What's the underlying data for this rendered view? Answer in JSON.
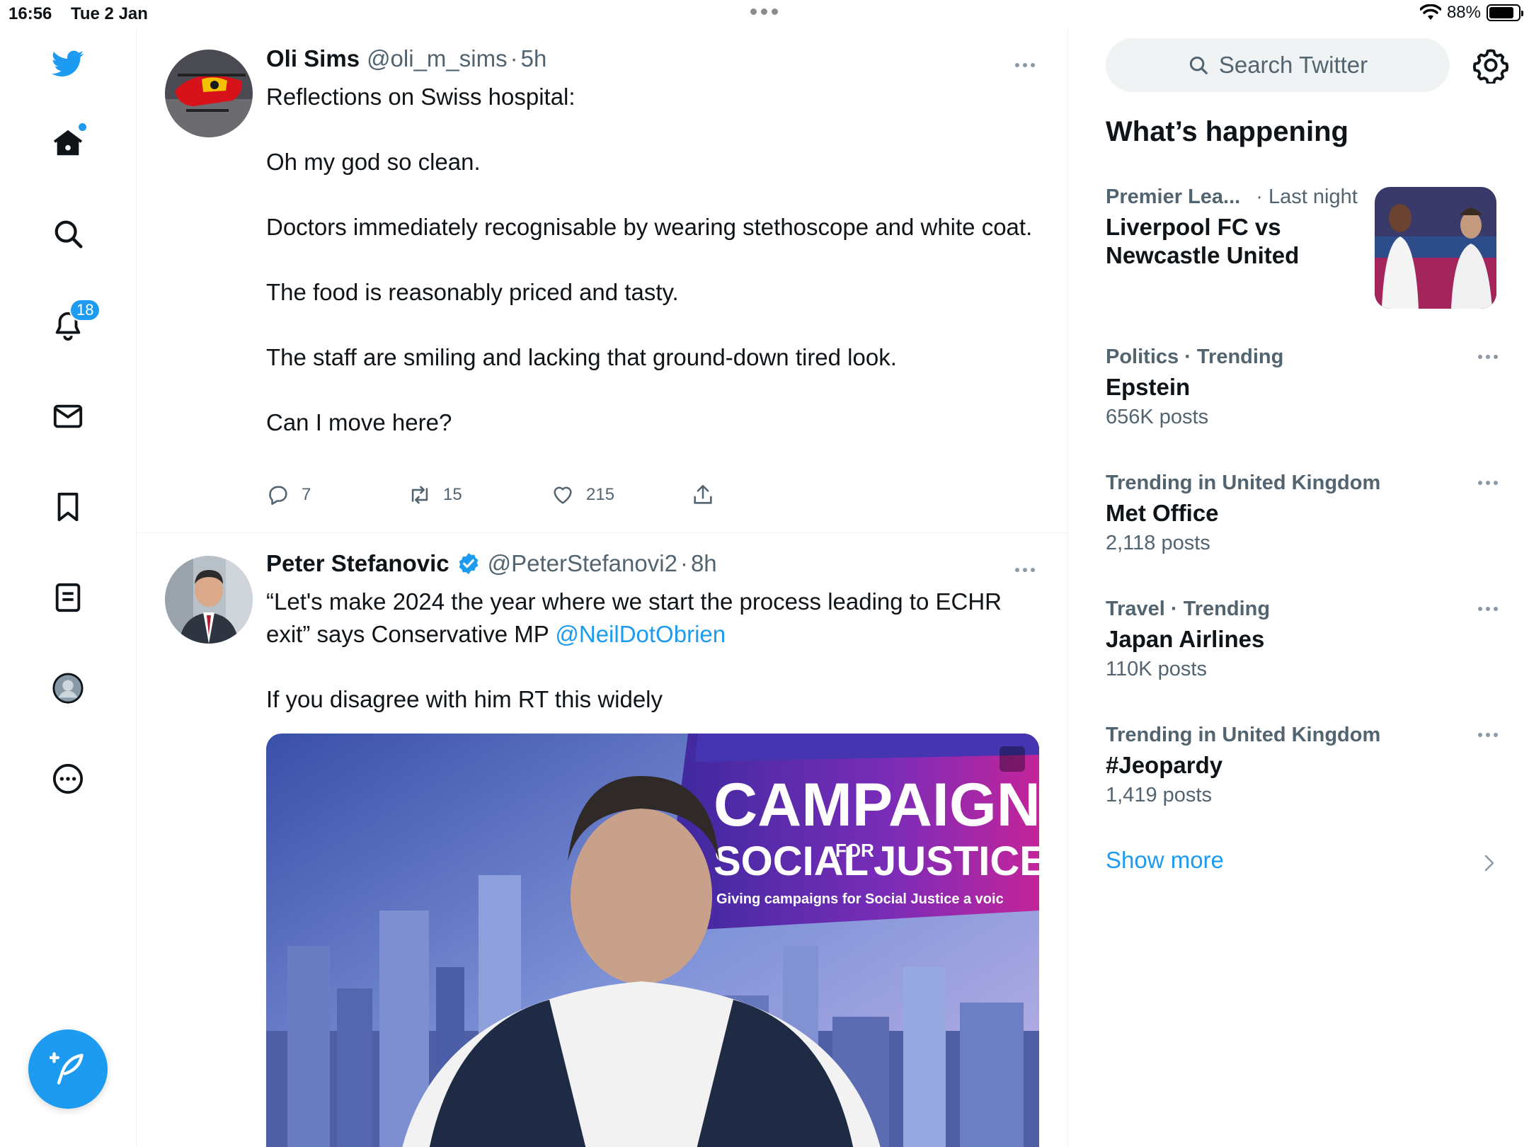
{
  "status_bar": {
    "time": "16:56",
    "date": "Tue 2 Jan",
    "battery_percent": "88%",
    "battery_level": 0.88
  },
  "nav": {
    "icons": [
      "twitter-logo-icon",
      "home-icon",
      "search-icon",
      "bell-icon",
      "mail-icon",
      "bookmark-icon",
      "lists-icon",
      "profile-icon",
      "more-circle-icon"
    ],
    "notification_count": "18",
    "accent": "#1d9bf0"
  },
  "timeline": {
    "tweets": [
      {
        "display_name": "Oli Sims",
        "handle": "@oli_m_sims",
        "separator": "·",
        "time": "5h",
        "lines": [
          "Reflections on Swiss hospital:",
          "Oh my god so clean.",
          "Doctors immediately recognisable by wearing stethoscope and white coat.",
          "The food is reasonably priced and tasty.",
          "The staff are smiling and lacking that ground-down tired look.",
          "Can I move here?"
        ],
        "replies": "7",
        "retweets": "15",
        "likes": "215"
      },
      {
        "display_name": "Peter Stefanovic",
        "handle": "@PeterStefanovi2",
        "separator": "·",
        "time": "8h",
        "text_before_mention": "“Let's make 2024 the year where we start the process leading to ECHR exit” says Conservative MP ",
        "mention": "@NeilDotObrien",
        "text_after": "If you disagree with him RT this widely",
        "media": {
          "banner_title": "CAMPAIGN",
          "banner_subtitle_left": "SOCIAL",
          "banner_subtitle_for": "FOR",
          "banner_subtitle_right": "JUSTICE",
          "banner_tagline": "Giving campaigns for Social Justice a voic"
        }
      }
    ]
  },
  "sidebar": {
    "search_placeholder": "Search Twitter",
    "section_title": "What’s happening",
    "trends": [
      {
        "category": "Premier Lea...",
        "time": "· Last night",
        "name_line1": "Liverpool FC vs",
        "name_line2": "Newcastle United"
      },
      {
        "category": "Politics · Trending",
        "name": "Epstein",
        "count": "656K posts"
      },
      {
        "category": "Trending in United Kingdom",
        "name": "Met Office",
        "count": "2,118 posts"
      },
      {
        "category": "Travel · Trending",
        "name": "Japan Airlines",
        "count": "110K posts"
      },
      {
        "category": "Trending in United Kingdom",
        "name": "#Jeopardy",
        "count": "1,419 posts"
      }
    ],
    "show_more": "Show more"
  }
}
